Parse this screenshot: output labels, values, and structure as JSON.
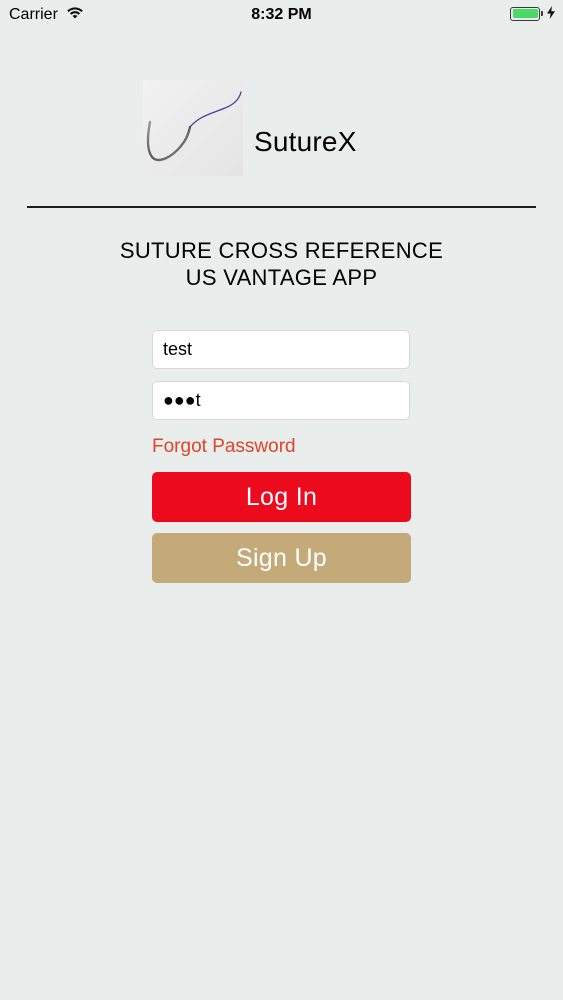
{
  "status_bar": {
    "carrier": "Carrier",
    "time": "8:32 PM",
    "battery_level": 1.0
  },
  "header": {
    "brand_name": "SutureX"
  },
  "title": {
    "line1": "SUTURE CROSS REFERENCE",
    "line2": "US VANTAGE APP"
  },
  "login_form": {
    "username_value": "test",
    "password_value": "●●●t",
    "forgot_password_label": "Forgot Password",
    "login_label": "Log In",
    "signup_label": "Sign Up"
  },
  "colors": {
    "background": "#e9edec",
    "login_button": "#ec0a1d",
    "signup_button": "#c4aa79",
    "forgot_link": "#e0442a",
    "battery_fill": "#4cd964"
  },
  "icons": {
    "wifi": "wifi-icon",
    "battery": "battery-icon",
    "charging": "charging-icon",
    "logo": "suture-logo-icon"
  }
}
